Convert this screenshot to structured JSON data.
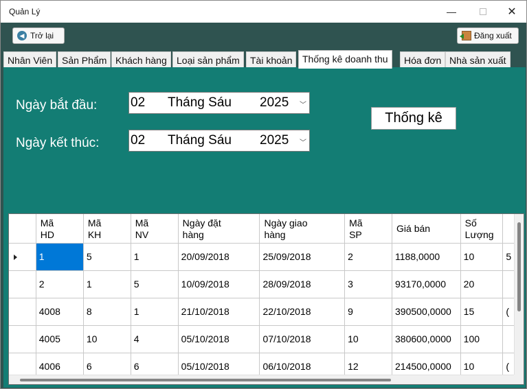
{
  "window": {
    "title": "Quản Lý"
  },
  "toolbar": {
    "back_label": "Trở lại",
    "logout_label": "Đăng xuất"
  },
  "tabs": [
    {
      "label": "Nhân Viên"
    },
    {
      "label": "Sản Phẩm"
    },
    {
      "label": "Khách hàng"
    },
    {
      "label": "Loại sản phẩm"
    },
    {
      "label": "Tài khoản"
    },
    {
      "label": "Thống kê doanh thu",
      "active": true
    },
    {
      "label": "Hóa đơn"
    },
    {
      "label": "Nhà sản xuất"
    }
  ],
  "filter": {
    "start_label": "Ngày bắt đầu:",
    "end_label": "Ngày kết thúc:",
    "start_date": {
      "day": "02",
      "month": "Tháng Sáu",
      "year": "2025"
    },
    "end_date": {
      "day": "02",
      "month": "Tháng Sáu",
      "year": "2025"
    },
    "stat_button": "Thống kê"
  },
  "grid": {
    "columns": [
      {
        "line1": "Mã",
        "line2": "HD"
      },
      {
        "line1": "Mã",
        "line2": "KH"
      },
      {
        "line1": "Mã",
        "line2": "NV"
      },
      {
        "line1": "Ngày đặt",
        "line2": "hàng"
      },
      {
        "line1": "Ngày giao",
        "line2": "hàng"
      },
      {
        "line1": "Mã",
        "line2": "SP"
      },
      {
        "line1": "Giá bán",
        "line2": ""
      },
      {
        "line1": "Số",
        "line2": "Lượng"
      }
    ],
    "rows": [
      [
        "1",
        "5",
        "1",
        "20/09/2018",
        "25/09/2018",
        "2",
        "1188,0000",
        "10",
        "5"
      ],
      [
        "2",
        "1",
        "5",
        "10/09/2018",
        "28/09/2018",
        "3",
        "93170,0000",
        "20",
        ""
      ],
      [
        "4008",
        "8",
        "1",
        "21/10/2018",
        "22/10/2018",
        "9",
        "390500,0000",
        "15",
        "("
      ],
      [
        "4005",
        "10",
        "4",
        "05/10/2018",
        "07/10/2018",
        "10",
        "380600,0000",
        "100",
        ""
      ],
      [
        "4006",
        "6",
        "6",
        "05/10/2018",
        "06/10/2018",
        "12",
        "214500,0000",
        "10",
        "("
      ]
    ],
    "selected_row": 0,
    "selected_col": 0
  },
  "colors": {
    "content_bg": "#137d74",
    "frame_bg": "#2f5350",
    "selection": "#0078d7"
  }
}
